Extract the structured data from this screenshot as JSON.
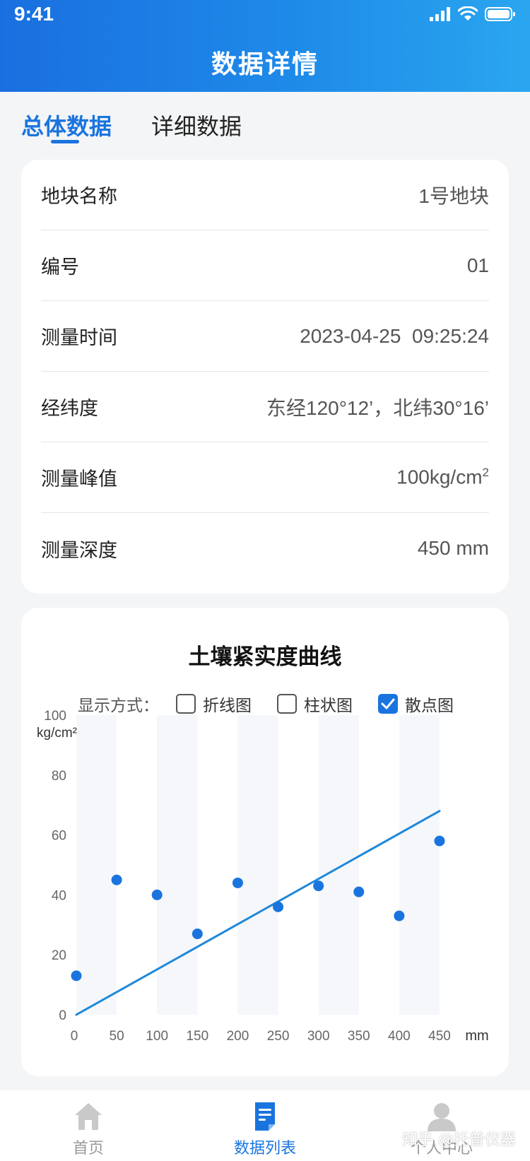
{
  "status_bar": {
    "time": "9:41"
  },
  "header": {
    "title": "数据详情"
  },
  "tabs": [
    {
      "label": "总体数据",
      "active": true
    },
    {
      "label": "详细数据",
      "active": false
    }
  ],
  "info": {
    "rows": [
      {
        "label": "地块名称",
        "value": "1号地块"
      },
      {
        "label": "编号",
        "value": "01"
      },
      {
        "label": "测量时间",
        "value": "2023-04-25  09:25:24"
      },
      {
        "label": "经纬度",
        "value": "东经120°12’，北纬30°16’"
      },
      {
        "label": "测量峰值",
        "value": "100kg/cm",
        "sup": "2"
      },
      {
        "label": "测量深度",
        "value": "450 mm"
      }
    ]
  },
  "chart": {
    "display_mode_label": "显示方式：",
    "options": [
      {
        "label": "折线图",
        "checked": false
      },
      {
        "label": "柱状图",
        "checked": false
      },
      {
        "label": "散点图",
        "checked": true
      }
    ]
  },
  "chart_data": {
    "type": "scatter",
    "title": "土壤紧实度曲线",
    "xlabel": "mm",
    "ylabel": "kg/cm²",
    "xlim": [
      0,
      450
    ],
    "ylim": [
      0,
      100
    ],
    "x_ticks": [
      0,
      50,
      100,
      150,
      200,
      250,
      300,
      350,
      400,
      450
    ],
    "y_ticks": [
      0,
      20,
      40,
      60,
      80,
      100
    ],
    "points": [
      {
        "x": 0,
        "y": 13
      },
      {
        "x": 50,
        "y": 45
      },
      {
        "x": 100,
        "y": 40
      },
      {
        "x": 150,
        "y": 27
      },
      {
        "x": 200,
        "y": 44
      },
      {
        "x": 250,
        "y": 36
      },
      {
        "x": 300,
        "y": 43
      },
      {
        "x": 350,
        "y": 41
      },
      {
        "x": 400,
        "y": 33
      },
      {
        "x": 450,
        "y": 58
      }
    ],
    "trendline": {
      "from": [
        0,
        0
      ],
      "to": [
        450,
        68
      ]
    },
    "colors": {
      "point": "#1a74de",
      "trend": "#1e88d9",
      "band": "#f5f7fb"
    },
    "grid": false
  },
  "bottom_nav": [
    {
      "label": "首页",
      "icon": "home-icon",
      "active": false
    },
    {
      "label": "数据列表",
      "icon": "document-list-icon",
      "active": true
    },
    {
      "label": "个人中心",
      "icon": "user-icon",
      "active": false
    }
  ],
  "watermark": "知乎 @托普仪器"
}
